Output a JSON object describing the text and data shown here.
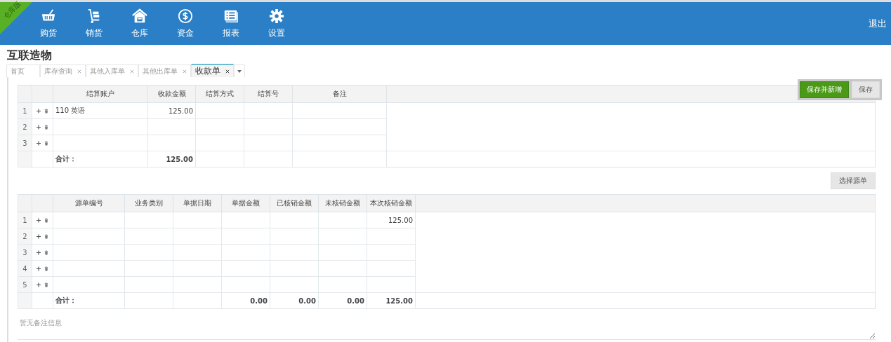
{
  "corner_badge": "仓库版",
  "nav": [
    {
      "label": "购货"
    },
    {
      "label": "销货"
    },
    {
      "label": "仓库"
    },
    {
      "label": "资金"
    },
    {
      "label": "报表"
    },
    {
      "label": "设置"
    }
  ],
  "logout": "退出",
  "company": "互联造物",
  "tabs": [
    {
      "label": "首页",
      "closable": false,
      "selected": false
    },
    {
      "label": "库存查询",
      "closable": true,
      "selected": false
    },
    {
      "label": "其他入库单",
      "closable": true,
      "selected": false
    },
    {
      "label": "其他出库单",
      "closable": true,
      "selected": false
    },
    {
      "label": "收款单",
      "closable": true,
      "selected": true
    }
  ],
  "toolbar": [
    {
      "label": "保存并新增",
      "kind": "primary"
    },
    {
      "label": "保存",
      "kind": "default"
    }
  ],
  "receipt_table": {
    "columns": [
      {
        "label": "结算账户",
        "kind": "text"
      },
      {
        "label": "收款金额",
        "kind": "number"
      },
      {
        "label": "结算方式",
        "kind": "text"
      },
      {
        "label": "结算号",
        "kind": "text"
      },
      {
        "label": "备注",
        "kind": "text"
      }
    ],
    "rows": [
      {
        "index": "1",
        "cells": [
          "110 英语",
          "125.00",
          null,
          null,
          null
        ]
      },
      {
        "index": "2",
        "cells": [
          null,
          null,
          null,
          null,
          null
        ]
      },
      {
        "index": "3",
        "cells": [
          null,
          null,
          null,
          null,
          null
        ]
      }
    ],
    "total_row": {
      "label": "合计：",
      "cells": [
        {
          "text": "125.00"
        },
        {},
        {},
        {}
      ]
    }
  },
  "select_source_button": "选择源单",
  "source_table": {
    "columns": [
      {
        "label": "源单编号",
        "kind": "text"
      },
      {
        "label": "业务类别",
        "kind": "text"
      },
      {
        "label": "单据日期",
        "kind": "text"
      },
      {
        "label": "单据金额",
        "kind": "number"
      },
      {
        "label": "已核销金额",
        "kind": "number"
      },
      {
        "label": "未核销金额",
        "kind": "number"
      },
      {
        "label": "本次核销金额",
        "kind": "number"
      }
    ],
    "rows": [
      {
        "index": "1",
        "cells": [
          null,
          null,
          null,
          null,
          null,
          null,
          "125.00"
        ]
      },
      {
        "index": "2",
        "cells": [
          null,
          null,
          null,
          null,
          null,
          null,
          null
        ]
      },
      {
        "index": "3",
        "cells": [
          null,
          null,
          null,
          null,
          null,
          null,
          null
        ]
      },
      {
        "index": "4",
        "cells": [
          null,
          null,
          null,
          null,
          null,
          null,
          null
        ]
      },
      {
        "index": "5",
        "cells": [
          null,
          null,
          null,
          null,
          null,
          null,
          null
        ]
      }
    ],
    "total_row": {
      "label": "合计：",
      "cells": [
        {},
        {},
        {
          "text": "0.00"
        },
        {
          "text": "0.00"
        },
        {
          "text": "0.00"
        },
        {
          "text": "125.00"
        }
      ]
    }
  },
  "remark": {
    "placeholder": "暂无备注信息"
  }
}
